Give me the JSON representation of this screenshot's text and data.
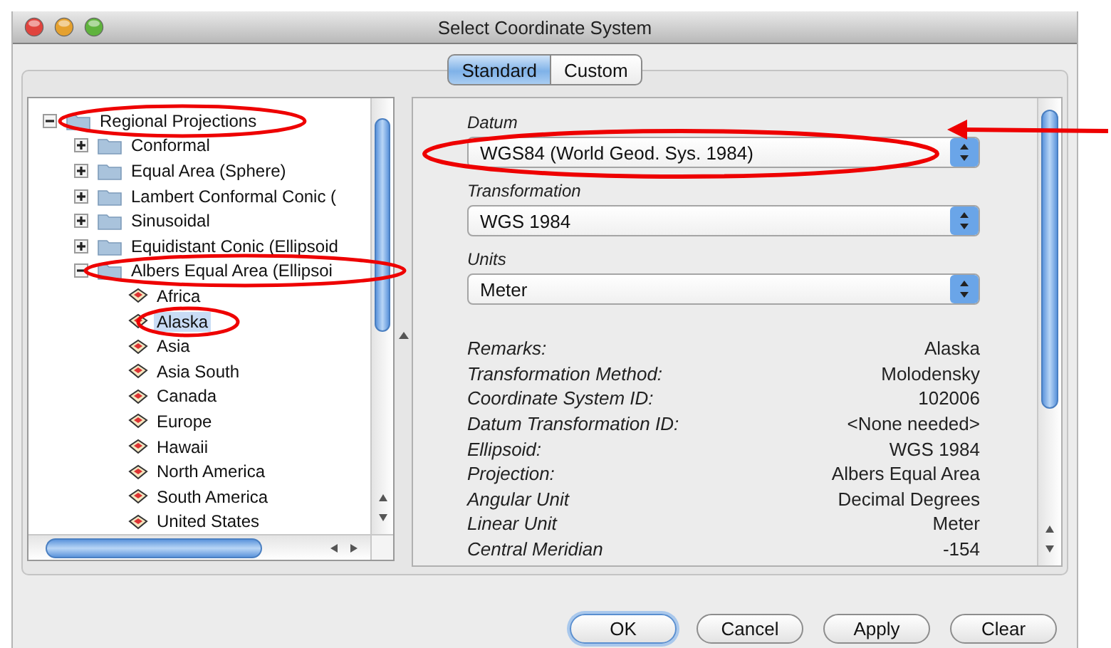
{
  "window": {
    "title": "Select Coordinate System"
  },
  "tabs": [
    {
      "label": "Standard",
      "selected": true
    },
    {
      "label": "Custom",
      "selected": false
    }
  ],
  "tree": [
    {
      "label": "Regional Projections",
      "kind": "folder",
      "expanded": true,
      "selected": false,
      "children": [
        {
          "label": "Conformal",
          "kind": "folder",
          "expanded": false,
          "selected": false
        },
        {
          "label": "Equal Area (Sphere)",
          "kind": "folder",
          "expanded": false,
          "selected": false
        },
        {
          "label": "Lambert Conformal Conic (",
          "kind": "folder",
          "expanded": false,
          "selected": false
        },
        {
          "label": "Sinusoidal",
          "kind": "folder",
          "expanded": false,
          "selected": false
        },
        {
          "label": "Equidistant Conic (Ellipsoid",
          "kind": "folder",
          "expanded": false,
          "selected": false
        },
        {
          "label": "Albers Equal Area (Ellipsoi",
          "kind": "folder",
          "expanded": true,
          "selected": false,
          "children": [
            {
              "label": "Africa",
              "kind": "projection",
              "selected": false
            },
            {
              "label": "Alaska",
              "kind": "projection",
              "selected": true
            },
            {
              "label": "Asia",
              "kind": "projection",
              "selected": false
            },
            {
              "label": "Asia South",
              "kind": "projection",
              "selected": false
            },
            {
              "label": "Canada",
              "kind": "projection",
              "selected": false
            },
            {
              "label": "Europe",
              "kind": "projection",
              "selected": false
            },
            {
              "label": "Hawaii",
              "kind": "projection",
              "selected": false
            },
            {
              "label": "North America",
              "kind": "projection",
              "selected": false
            },
            {
              "label": "South America",
              "kind": "projection",
              "selected": false
            },
            {
              "label": "United States",
              "kind": "projection",
              "selected": false
            }
          ]
        }
      ]
    }
  ],
  "selects": [
    {
      "label": "Datum",
      "value": "WGS84 (World Geod. Sys. 1984)"
    },
    {
      "label": "Transformation",
      "value": "WGS 1984"
    },
    {
      "label": "Units",
      "value": "Meter"
    }
  ],
  "details": [
    {
      "label": "Remarks:",
      "value": "Alaska"
    },
    {
      "label": "Transformation Method:",
      "value": "Molodensky"
    },
    {
      "label": "Coordinate System ID:",
      "value": "102006"
    },
    {
      "label": "Datum Transformation ID:",
      "value": "<None needed>"
    },
    {
      "label": "Ellipsoid:",
      "value": "WGS 1984"
    },
    {
      "label": "Projection:",
      "value": "Albers Equal Area"
    },
    {
      "label": "Angular Unit",
      "value": "Decimal Degrees"
    },
    {
      "label": "Linear Unit",
      "value": "Meter"
    },
    {
      "label": "Central Meridian",
      "value": "-154"
    }
  ],
  "buttons": [
    {
      "label": "OK",
      "default": true
    },
    {
      "label": "Cancel",
      "default": false
    },
    {
      "label": "Apply",
      "default": false
    },
    {
      "label": "Clear",
      "default": false
    }
  ]
}
